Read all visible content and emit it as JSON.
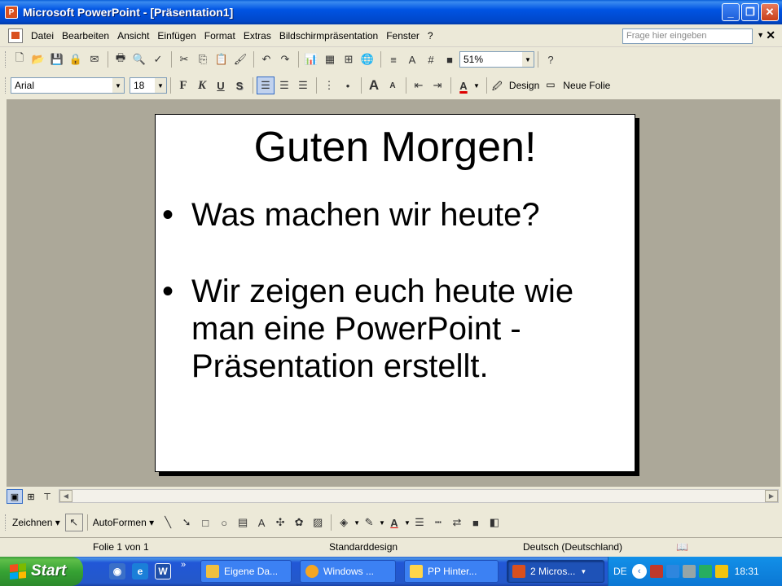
{
  "window": {
    "title": "Microsoft PowerPoint - [Präsentation1]",
    "minimize": "_",
    "maximize": "❐",
    "close": "✕"
  },
  "menu": {
    "items": [
      "Datei",
      "Bearbeiten",
      "Ansicht",
      "Einfügen",
      "Format",
      "Extras",
      "Bildschirmpräsentation",
      "Fenster",
      "?"
    ],
    "ask_placeholder": "Frage hier eingeben",
    "doc_close": "✕"
  },
  "standard_toolbar": {
    "zoom": "51%"
  },
  "format_toolbar": {
    "font": "Arial",
    "size": "18",
    "design_label": "Design",
    "new_slide_label": "Neue Folie"
  },
  "slide": {
    "title": "Guten Morgen!",
    "bullets": [
      "Was machen wir heute?",
      "Wir zeigen euch heute wie man eine PowerPoint - Präsentation erstellt."
    ]
  },
  "drawing_toolbar": {
    "draw_label": "Zeichnen",
    "autoshapes_label": "AutoFormen"
  },
  "status": {
    "slide_info": "Folie 1 von 1",
    "design": "Standarddesign",
    "language": "Deutsch (Deutschland)"
  },
  "taskbar": {
    "start": "Start",
    "tasks": [
      "Eigene Da...",
      "Windows ...",
      "PP Hinter...",
      "2 Micros..."
    ],
    "lang": "DE",
    "clock": "18:31"
  }
}
